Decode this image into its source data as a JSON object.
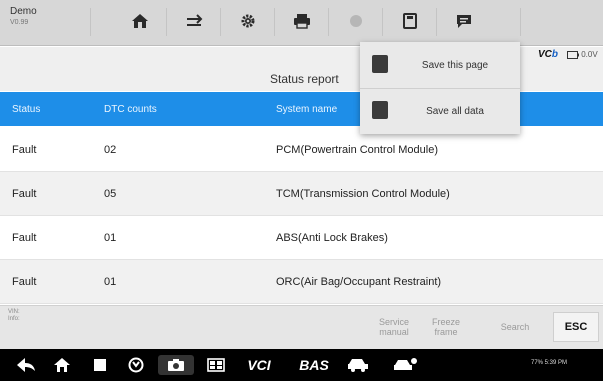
{
  "app": {
    "name": "Demo",
    "version": "V0.99"
  },
  "toolbar": {
    "buttons": [
      {
        "icon": "home-icon"
      },
      {
        "icon": "vehicle-swap-icon"
      },
      {
        "icon": "gear-icon"
      },
      {
        "icon": "printer-icon"
      },
      {
        "icon": "camera-icon"
      },
      {
        "icon": "save-icon"
      },
      {
        "icon": "message-icon"
      }
    ]
  },
  "report": {
    "title": "Status report"
  },
  "vcb": {
    "prefix": "VC",
    "highlight": "b",
    "extra": "0.0V"
  },
  "save_menu": {
    "items": [
      {
        "label": "Save this page",
        "icon": "image-icon"
      },
      {
        "label": "Save all data",
        "icon": "pdf-icon"
      }
    ]
  },
  "table": {
    "headers": [
      "Status",
      "DTC counts",
      "System name"
    ],
    "rows": [
      {
        "status": "Fault",
        "dtc": "02",
        "system": "PCM(Powertrain Control Module)"
      },
      {
        "status": "Fault",
        "dtc": "05",
        "system": "TCM(Transmission Control Module)"
      },
      {
        "status": "Fault",
        "dtc": "01",
        "system": "ABS(Anti Lock Brakes)"
      },
      {
        "status": "Fault",
        "dtc": "01",
        "system": "ORC(Air Bag/Occupant Restraint)"
      }
    ]
  },
  "info": {
    "vin": "VIN:",
    "info": "Info:"
  },
  "actions": {
    "service_line1": "Service",
    "service_line2": "manual",
    "freeze_line1": "Freeze",
    "freeze_line2": "frame",
    "search": "Search",
    "esc": "ESC"
  },
  "navbar": {
    "vci_label": "VCI",
    "bas_label": "BAS",
    "status": "77% 5:39 PM"
  },
  "colors": {
    "header_blue": "#1e8ee8",
    "toolbar_gray": "#d7d7d7",
    "navbar_black": "#000000"
  }
}
